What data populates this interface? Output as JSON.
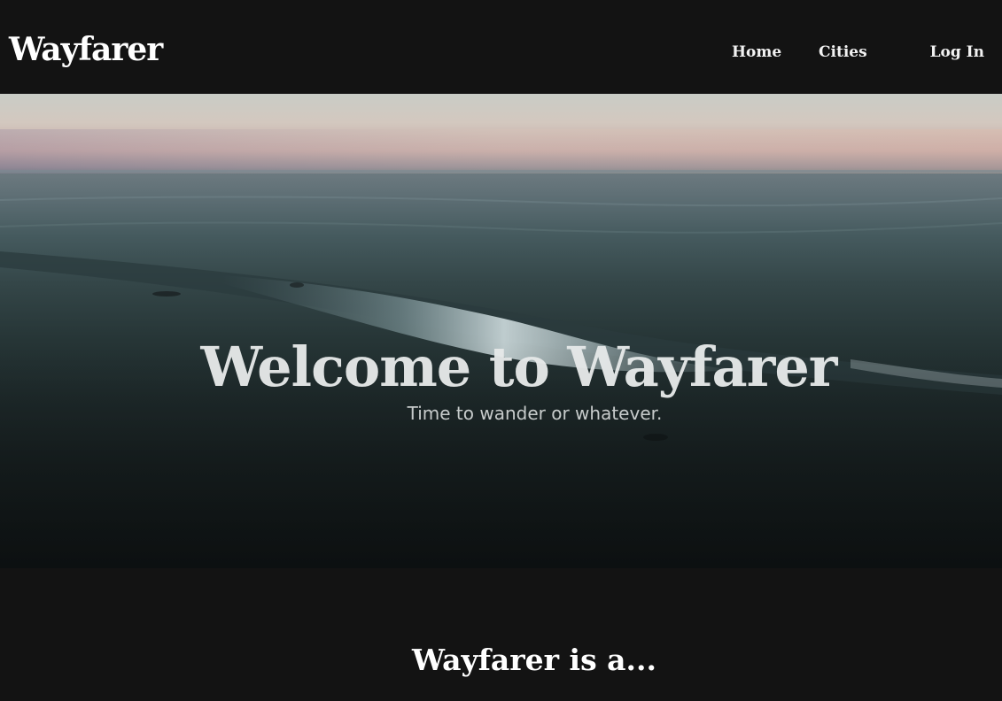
{
  "navbar": {
    "brand": "Wayfarer",
    "links": [
      {
        "label": "Home"
      },
      {
        "label": "Cities"
      },
      {
        "label": "Log In"
      }
    ]
  },
  "hero": {
    "title": "Welcome to Wayfarer",
    "subtitle": "Time to wander or whatever."
  },
  "about": {
    "heading": "Wayfarer is a..."
  },
  "colors": {
    "background": "#131313",
    "text": "#ffffff"
  }
}
